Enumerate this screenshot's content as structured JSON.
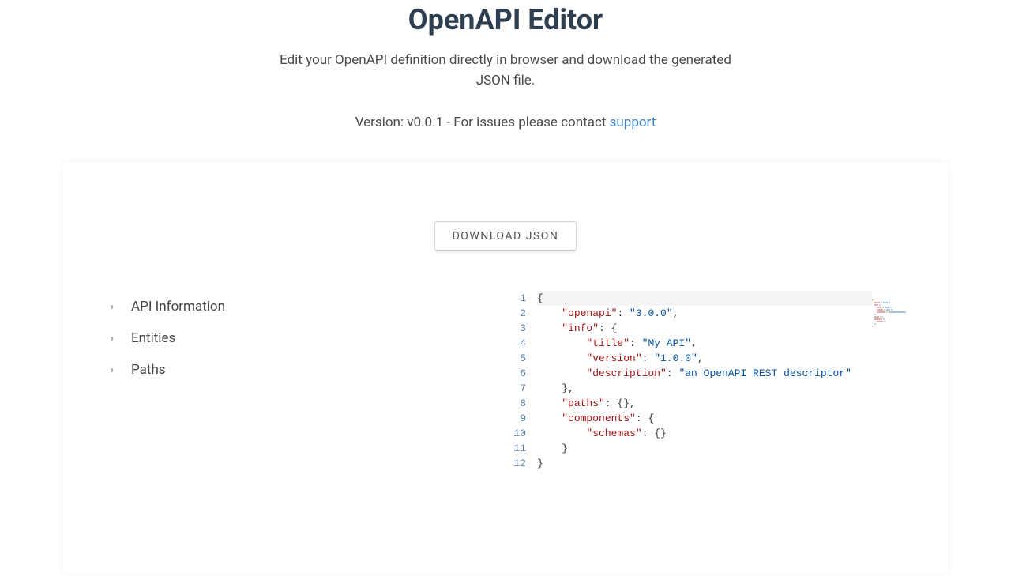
{
  "header": {
    "title": "OpenAPI Editor",
    "subtitle": "Edit your OpenAPI definition directly in browser and download the generated JSON file.",
    "version_prefix": "Version: ",
    "version": "v0.0.1",
    "issues_text": " - For issues please contact ",
    "support_link": "support"
  },
  "actions": {
    "download_label": "DOWNLOAD JSON"
  },
  "sidebar": {
    "items": [
      {
        "label": "API Information"
      },
      {
        "label": "Entities"
      },
      {
        "label": "Paths"
      }
    ]
  },
  "editor": {
    "line_count": 12,
    "lines": [
      {
        "n": 1,
        "tokens": [
          {
            "t": "{",
            "c": "punc"
          }
        ],
        "hl": true
      },
      {
        "n": 2,
        "indent": 4,
        "tokens": [
          {
            "t": "\"openapi\"",
            "c": "key"
          },
          {
            "t": ": ",
            "c": "punc"
          },
          {
            "t": "\"3.0.0\"",
            "c": "str"
          },
          {
            "t": ",",
            "c": "punc"
          }
        ]
      },
      {
        "n": 3,
        "indent": 4,
        "tokens": [
          {
            "t": "\"info\"",
            "c": "key"
          },
          {
            "t": ": {",
            "c": "punc"
          }
        ]
      },
      {
        "n": 4,
        "indent": 8,
        "tokens": [
          {
            "t": "\"title\"",
            "c": "key"
          },
          {
            "t": ": ",
            "c": "punc"
          },
          {
            "t": "\"My API\"",
            "c": "str"
          },
          {
            "t": ",",
            "c": "punc"
          }
        ]
      },
      {
        "n": 5,
        "indent": 8,
        "tokens": [
          {
            "t": "\"version\"",
            "c": "key"
          },
          {
            "t": ": ",
            "c": "punc"
          },
          {
            "t": "\"1.0.0\"",
            "c": "str"
          },
          {
            "t": ",",
            "c": "punc"
          }
        ]
      },
      {
        "n": 6,
        "indent": 8,
        "tokens": [
          {
            "t": "\"description\"",
            "c": "key"
          },
          {
            "t": ": ",
            "c": "punc"
          },
          {
            "t": "\"an OpenAPI REST descriptor\"",
            "c": "str"
          }
        ]
      },
      {
        "n": 7,
        "indent": 4,
        "tokens": [
          {
            "t": "},",
            "c": "punc"
          }
        ]
      },
      {
        "n": 8,
        "indent": 4,
        "tokens": [
          {
            "t": "\"paths\"",
            "c": "key"
          },
          {
            "t": ": {},",
            "c": "punc"
          }
        ]
      },
      {
        "n": 9,
        "indent": 4,
        "tokens": [
          {
            "t": "\"components\"",
            "c": "key"
          },
          {
            "t": ": {",
            "c": "punc"
          }
        ]
      },
      {
        "n": 10,
        "indent": 8,
        "tokens": [
          {
            "t": "\"schemas\"",
            "c": "key"
          },
          {
            "t": ": {}",
            "c": "punc"
          }
        ]
      },
      {
        "n": 11,
        "indent": 4,
        "tokens": [
          {
            "t": "}",
            "c": "punc"
          }
        ]
      },
      {
        "n": 12,
        "tokens": [
          {
            "t": "}",
            "c": "punc"
          }
        ]
      }
    ]
  }
}
